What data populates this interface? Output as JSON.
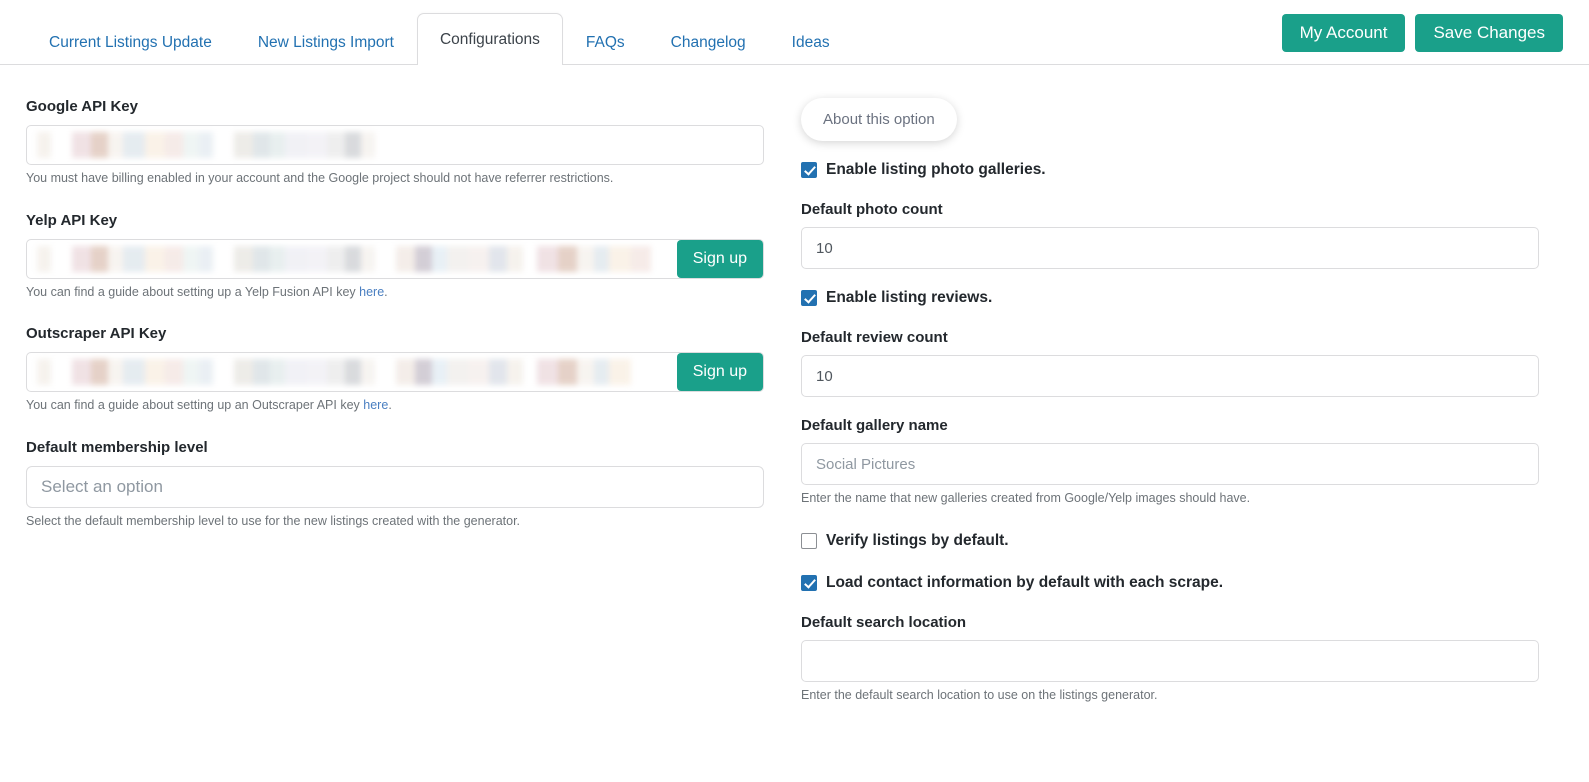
{
  "nav": {
    "tabs": [
      {
        "label": "Current Listings Update",
        "active": false
      },
      {
        "label": "New Listings Import",
        "active": false
      },
      {
        "label": "Configurations",
        "active": true
      },
      {
        "label": "FAQs",
        "active": false
      },
      {
        "label": "Changelog",
        "active": false
      },
      {
        "label": "Ideas",
        "active": false
      }
    ],
    "my_account_label": "My Account",
    "save_changes_label": "Save Changes"
  },
  "colors": {
    "accent_teal": "#1aa08a",
    "link_blue": "#2271b1",
    "checkbox_blue": "#2271b1"
  },
  "left": {
    "google_api": {
      "label": "Google API Key",
      "value": "",
      "redacted": true,
      "help": "You must have billing enabled in your account and the Google project should not have referrer restrictions."
    },
    "yelp_api": {
      "label": "Yelp API Key",
      "value": "",
      "redacted": true,
      "signup_label": "Sign up",
      "help_prefix": "You can find a guide about setting up a Yelp Fusion API key ",
      "help_link": "here",
      "help_suffix": "."
    },
    "outscraper_api": {
      "label": "Outscraper API Key",
      "value": "",
      "redacted": true,
      "signup_label": "Sign up",
      "help_prefix": "You can find a guide about setting up an Outscraper API key ",
      "help_link": "here",
      "help_suffix": "."
    },
    "membership": {
      "label": "Default membership level",
      "selected": "Select an option",
      "help": "Select the default membership level to use for the new listings created with the generator."
    }
  },
  "right": {
    "about_option_label": "About this option",
    "enable_photo_galleries": {
      "label": "Enable listing photo galleries.",
      "checked": true
    },
    "default_photo_count": {
      "label": "Default photo count",
      "value": "10"
    },
    "enable_reviews": {
      "label": "Enable listing reviews.",
      "checked": true
    },
    "default_review_count": {
      "label": "Default review count",
      "value": "10"
    },
    "default_gallery_name": {
      "label": "Default gallery name",
      "value": "Social Pictures",
      "help": "Enter the name that new galleries created from Google/Yelp images should have."
    },
    "verify_listings": {
      "label": "Verify listings by default.",
      "checked": false
    },
    "load_contact_info": {
      "label": "Load contact information by default with each scrape.",
      "checked": true
    },
    "default_search_location": {
      "label": "Default search location",
      "value": "",
      "help": "Enter the default search location to use on the listings generator."
    }
  }
}
